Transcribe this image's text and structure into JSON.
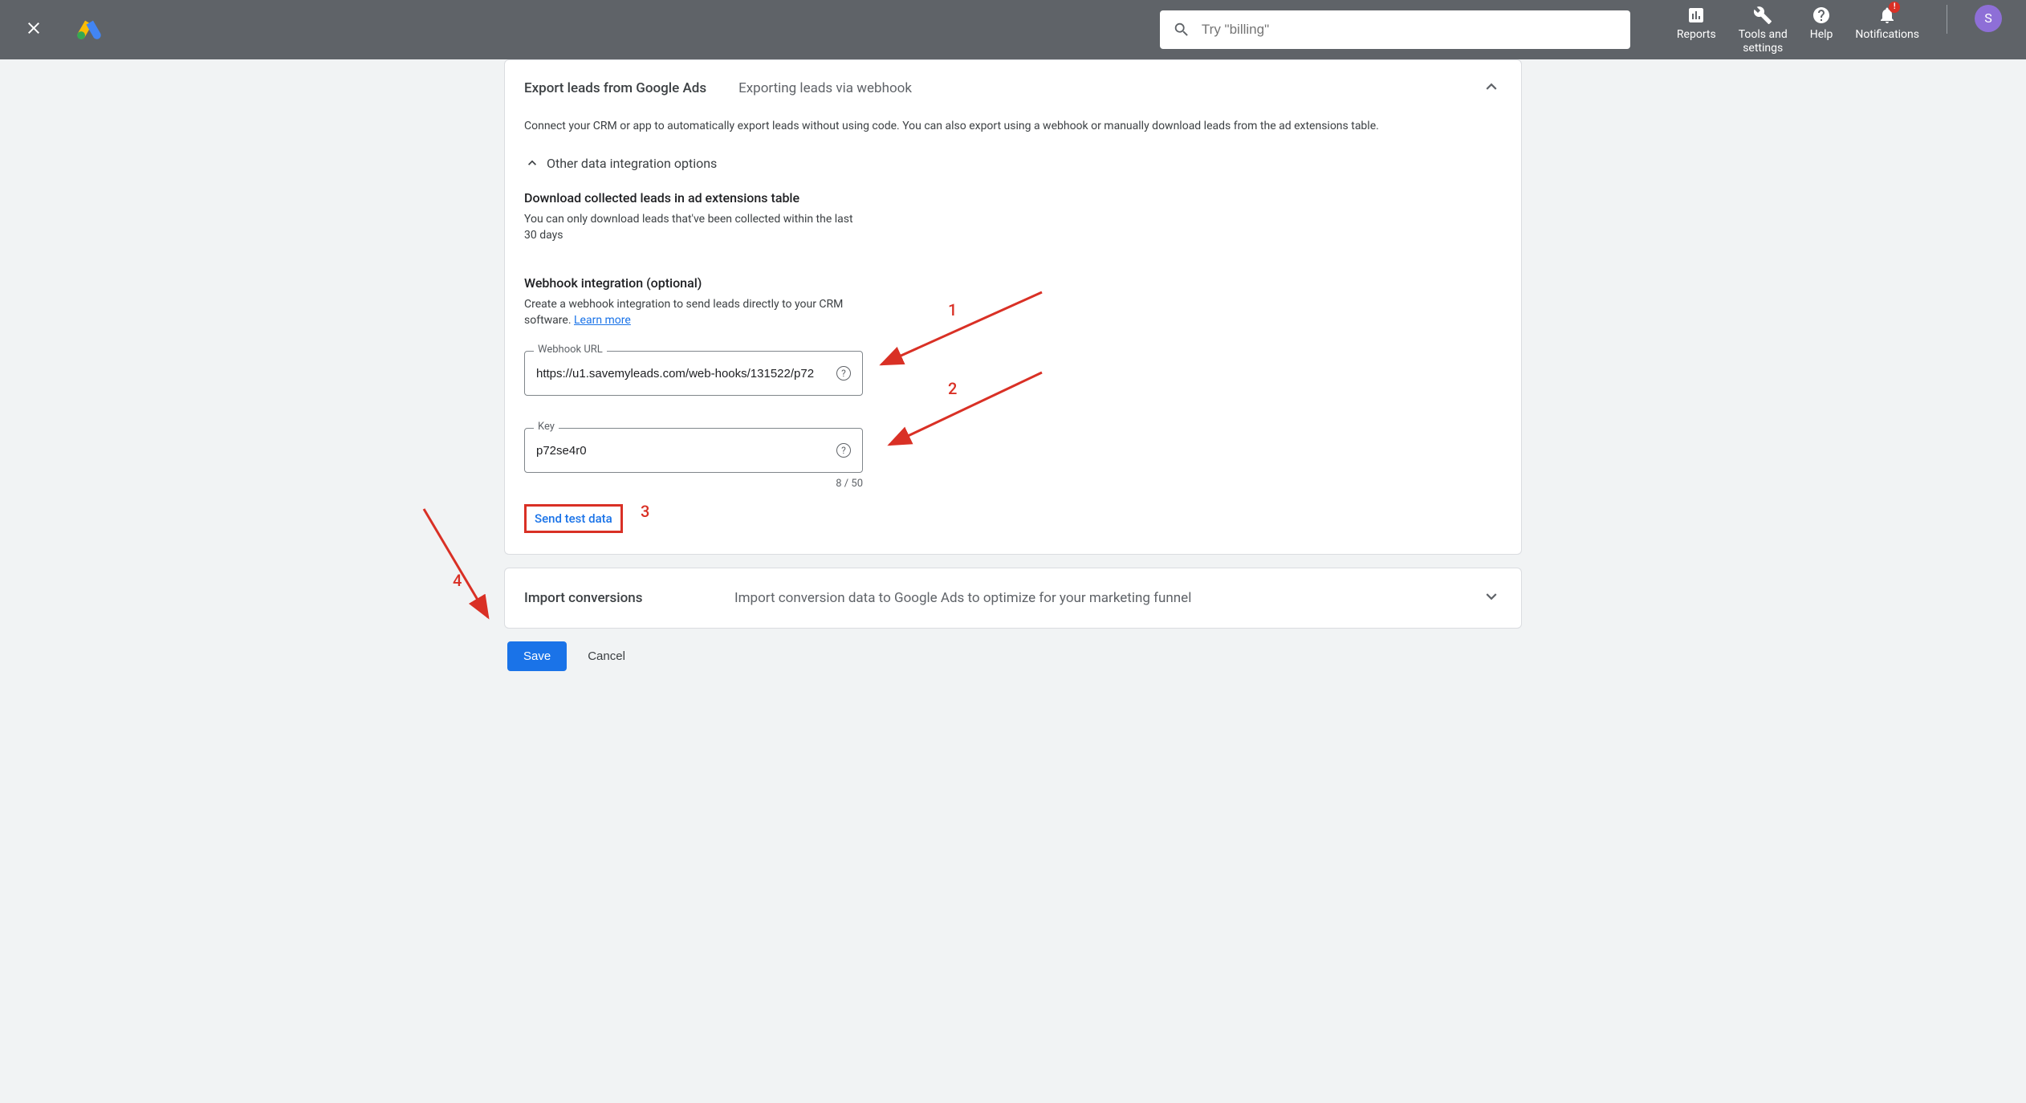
{
  "header": {
    "search_placeholder": "Try \"billing\"",
    "actions": {
      "reports": "Reports",
      "tools": "Tools and\nsettings",
      "help": "Help",
      "notifications": "Notifications"
    },
    "avatar_initial": "S"
  },
  "export_card": {
    "title": "Export leads from Google Ads",
    "subtitle": "Exporting leads via webhook",
    "description": "Connect your CRM or app to automatically export leads without using code. You can also export using a webhook or manually download leads from the ad extensions table.",
    "other_options_label": "Other data integration options",
    "download_section": {
      "heading": "Download collected leads in ad extensions table",
      "desc": "You can only download leads that've been collected within the last 30 days"
    },
    "webhook_section": {
      "heading": "Webhook integration (optional)",
      "desc_prefix": "Create a webhook integration to send leads directly to your CRM software. ",
      "learn_more": "Learn more",
      "url_label": "Webhook URL",
      "url_value": "https://u1.savemyleads.com/web-hooks/131522/p72",
      "key_label": "Key",
      "key_value": "p72se4r0",
      "key_counter": "8 / 50",
      "send_test": "Send test data"
    }
  },
  "import_card": {
    "title": "Import conversions",
    "desc": "Import conversion data to Google Ads to optimize for your marketing funnel"
  },
  "footer": {
    "save": "Save",
    "cancel": "Cancel"
  },
  "annotations": {
    "a1": "1",
    "a2": "2",
    "a3": "3",
    "a4": "4"
  }
}
